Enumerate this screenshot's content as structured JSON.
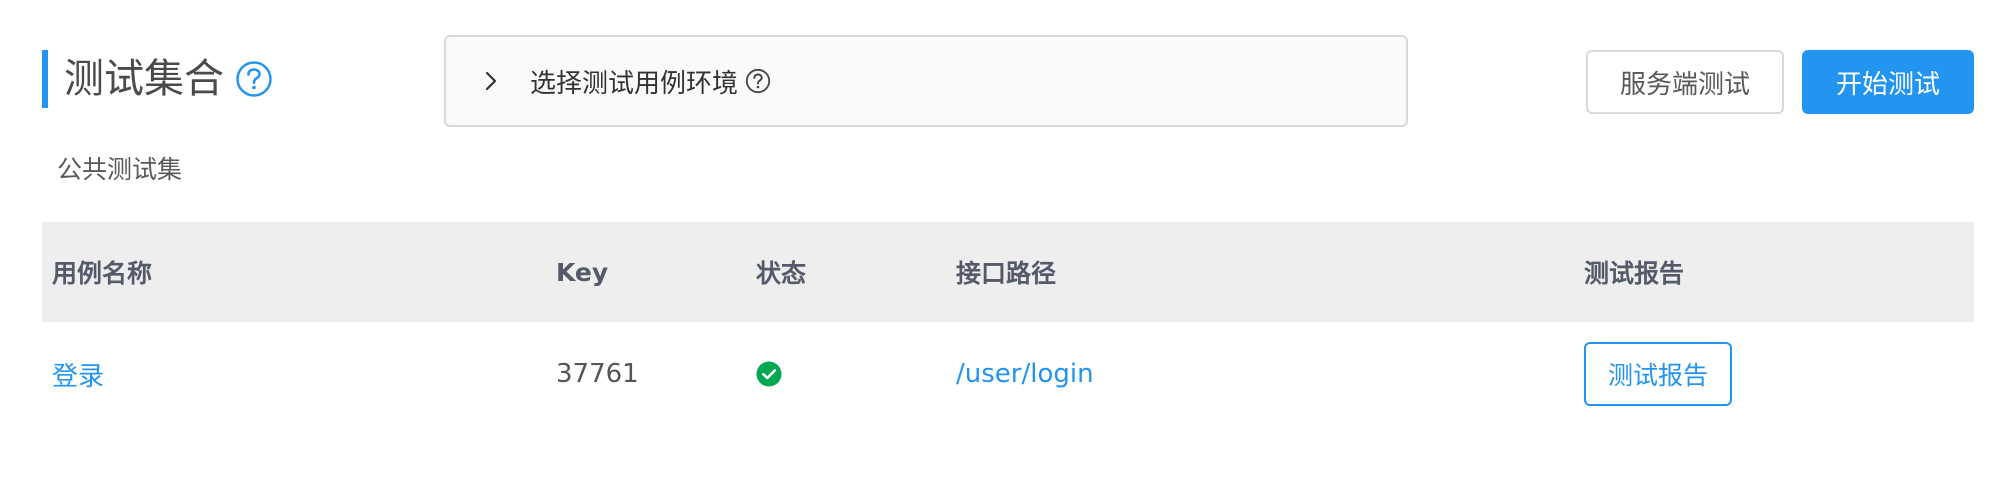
{
  "header": {
    "title": "测试集合",
    "help_icon": "question-circle-icon"
  },
  "env": {
    "label": "选择测试用例环境",
    "arrow_icon": "chevron-right-icon",
    "help_icon": "question-circle-icon"
  },
  "buttons": {
    "server_test": "服务端测试",
    "start_test": "开始测试"
  },
  "subtitle": "公共测试集",
  "table": {
    "columns": [
      "用例名称",
      "Key",
      "状态",
      "接口路径",
      "测试报告"
    ],
    "rows": [
      {
        "name": "登录",
        "key": "37761",
        "status_icon": "check-circle-icon",
        "path": "/user/login",
        "report": "测试报告"
      }
    ]
  },
  "colors": {
    "primary": "#2395f1",
    "success": "#00a854",
    "header_bg": "#eeeeee"
  }
}
